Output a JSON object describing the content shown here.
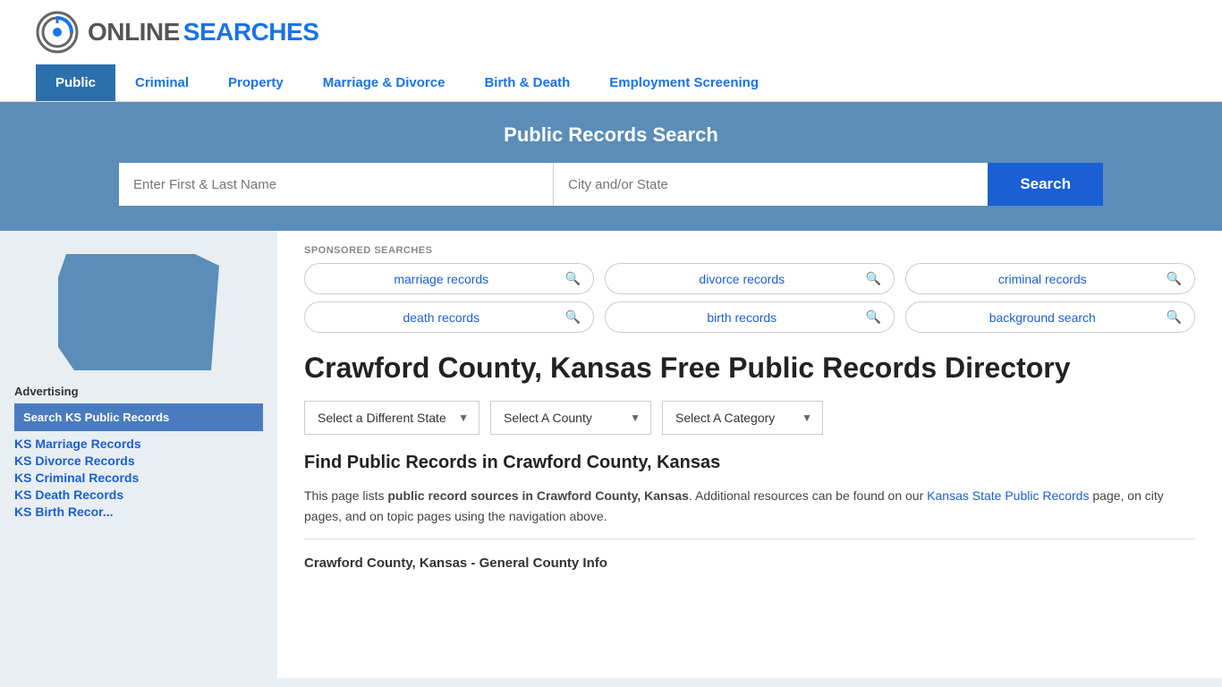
{
  "site": {
    "logo_online": "ONLINE",
    "logo_searches": "SEARCHES"
  },
  "nav": {
    "items": [
      {
        "label": "Public",
        "active": true
      },
      {
        "label": "Criminal",
        "active": false
      },
      {
        "label": "Property",
        "active": false
      },
      {
        "label": "Marriage & Divorce",
        "active": false
      },
      {
        "label": "Birth & Death",
        "active": false
      },
      {
        "label": "Employment Screening",
        "active": false
      }
    ]
  },
  "hero": {
    "title": "Public Records Search",
    "name_placeholder": "Enter First & Last Name",
    "location_placeholder": "City and/or State",
    "search_button": "Search"
  },
  "sponsored": {
    "label": "SPONSORED SEARCHES",
    "pills": [
      {
        "text": "marriage records"
      },
      {
        "text": "divorce records"
      },
      {
        "text": "criminal records"
      },
      {
        "text": "death records"
      },
      {
        "text": "birth records"
      },
      {
        "text": "background search"
      }
    ]
  },
  "page": {
    "heading": "Crawford County, Kansas Free Public Records Directory",
    "dropdowns": {
      "state": "Select a Different State",
      "county": "Select A County",
      "category": "Select A Category"
    },
    "find_heading": "Find Public Records in Crawford County, Kansas",
    "description_part1": "This page lists ",
    "description_bold": "public record sources in Crawford County, Kansas",
    "description_part2": ". Additional resources can be found on our ",
    "description_link": "Kansas State Public Records",
    "description_part3": " page, on city pages, and on topic pages using the navigation above.",
    "general_info": "Crawford County, Kansas - General County Info"
  },
  "sidebar": {
    "advertising_label": "Advertising",
    "ad_box_text": "Search KS Public Records",
    "links": [
      {
        "text": "KS Marriage Records"
      },
      {
        "text": "KS Divorce Records"
      },
      {
        "text": "KS Criminal Records"
      },
      {
        "text": "KS Death Records"
      },
      {
        "text": "KS Birth Recor..."
      }
    ]
  }
}
